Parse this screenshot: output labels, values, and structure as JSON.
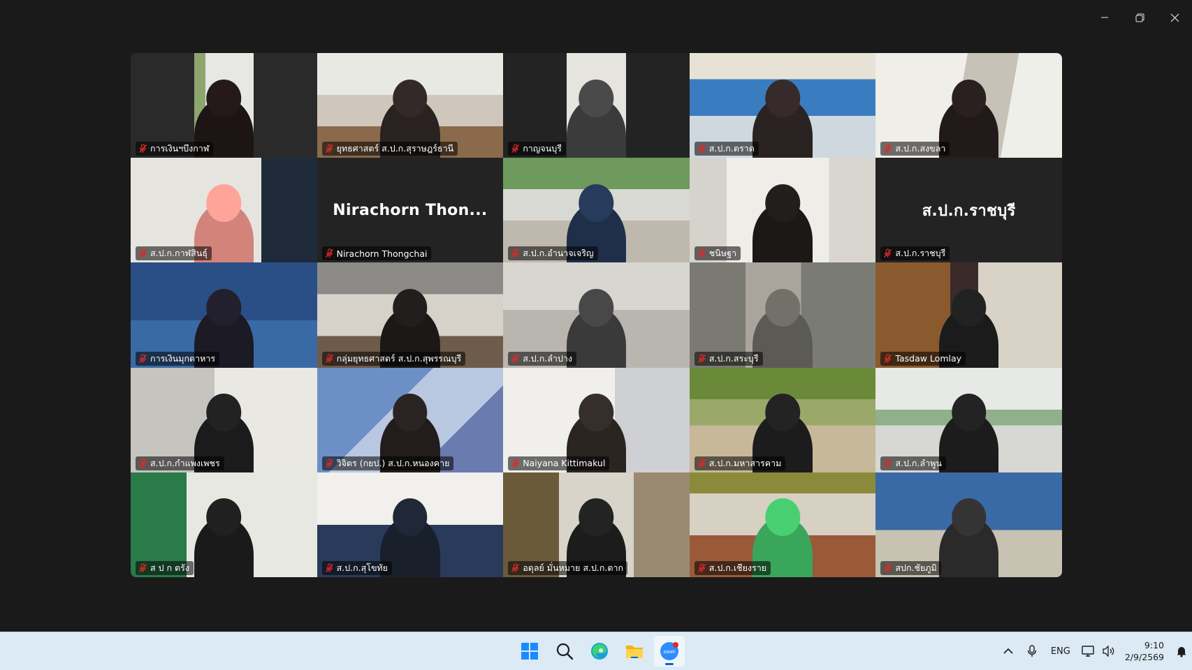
{
  "window": {
    "controls": [
      {
        "name": "minimize-button",
        "icon": "minimize-icon"
      },
      {
        "name": "restore-button",
        "icon": "restore-icon"
      },
      {
        "name": "close-button",
        "icon": "close-icon"
      }
    ]
  },
  "gallery": {
    "participants": [
      {
        "name": "การเงินฯบึงกาฬ",
        "muted": true,
        "video": true
      },
      {
        "name": "ยุทธศาสตร์ ส.ป.ก.สุราษฎร์ธานี",
        "muted": true,
        "video": true
      },
      {
        "name": "กาญจนบุรี",
        "muted": true,
        "video": true
      },
      {
        "name": "ส.ป.ก.ตราด",
        "muted": true,
        "video": true
      },
      {
        "name": "ส.ป.ก.สงขลา",
        "muted": true,
        "video": true
      },
      {
        "name": "ส.ป.ก.กาฬสินธุ์",
        "muted": true,
        "video": true
      },
      {
        "name": "Nirachorn Thongchai",
        "display_name": "Nirachorn  Thon...",
        "muted": true,
        "video": false
      },
      {
        "name": "ส.ป.ก.อำนาจเจริญ",
        "muted": true,
        "video": true
      },
      {
        "name": "ชนิษฐา",
        "muted": true,
        "video": true
      },
      {
        "name": "ส.ป.ก.ราชบุรี",
        "display_name": "ส.ป.ก.ราชบุรี",
        "muted": true,
        "video": false
      },
      {
        "name": "การเงินมุกดาหาร",
        "muted": true,
        "video": true
      },
      {
        "name": "กลุ่มยุทธศาสตร์ ส.ป.ก.สุพรรณบุรี",
        "muted": true,
        "video": true
      },
      {
        "name": "ส.ป.ก.ลำปาง",
        "muted": true,
        "video": true
      },
      {
        "name": "ส.ป.ก.สระบุรี",
        "muted": true,
        "video": true
      },
      {
        "name": "Tasdaw Lomlay",
        "muted": true,
        "video": true
      },
      {
        "name": "ส.ป.ก.กำแพงเพชร",
        "muted": true,
        "video": true
      },
      {
        "name": "วิจิตร (กยป.) ส.ป.ก.หนองคาย",
        "muted": true,
        "video": true
      },
      {
        "name": "Naiyana Kittimakul",
        "muted": true,
        "video": true
      },
      {
        "name": "ส.ป.ก.มหาสารคาม",
        "muted": true,
        "video": true
      },
      {
        "name": "ส.ป.ก.ลำพูน",
        "muted": true,
        "video": true
      },
      {
        "name": "ส ป ก ตรัง",
        "muted": true,
        "video": true
      },
      {
        "name": "ส.ป.ก.สุโขทัย",
        "muted": true,
        "video": true
      },
      {
        "name": "อดุลย์ มั่นหมาย ส.ป.ก.ตาก",
        "muted": true,
        "video": true
      },
      {
        "name": "ส.ป.ก.เชียงราย",
        "muted": true,
        "video": true
      },
      {
        "name": "สปก.ชัยภูมิ",
        "muted": true,
        "video": true
      }
    ]
  },
  "taskbar": {
    "apps": [
      {
        "name": "start",
        "icon": "windows-start-icon"
      },
      {
        "name": "search",
        "icon": "search-icon"
      },
      {
        "name": "edge",
        "icon": "edge-browser-icon"
      },
      {
        "name": "file-explorer",
        "icon": "folder-icon"
      },
      {
        "name": "zoom",
        "icon": "zoom-app-icon",
        "active": true
      }
    ],
    "tray": {
      "language": "ENG",
      "time": "9:10",
      "date": "2/9/2569"
    }
  },
  "colors": {
    "background": "#1a1a1a",
    "taskbar": "#dbeaf4",
    "mute_red": "#e02828",
    "zoom_blue": "#2d8cff"
  }
}
